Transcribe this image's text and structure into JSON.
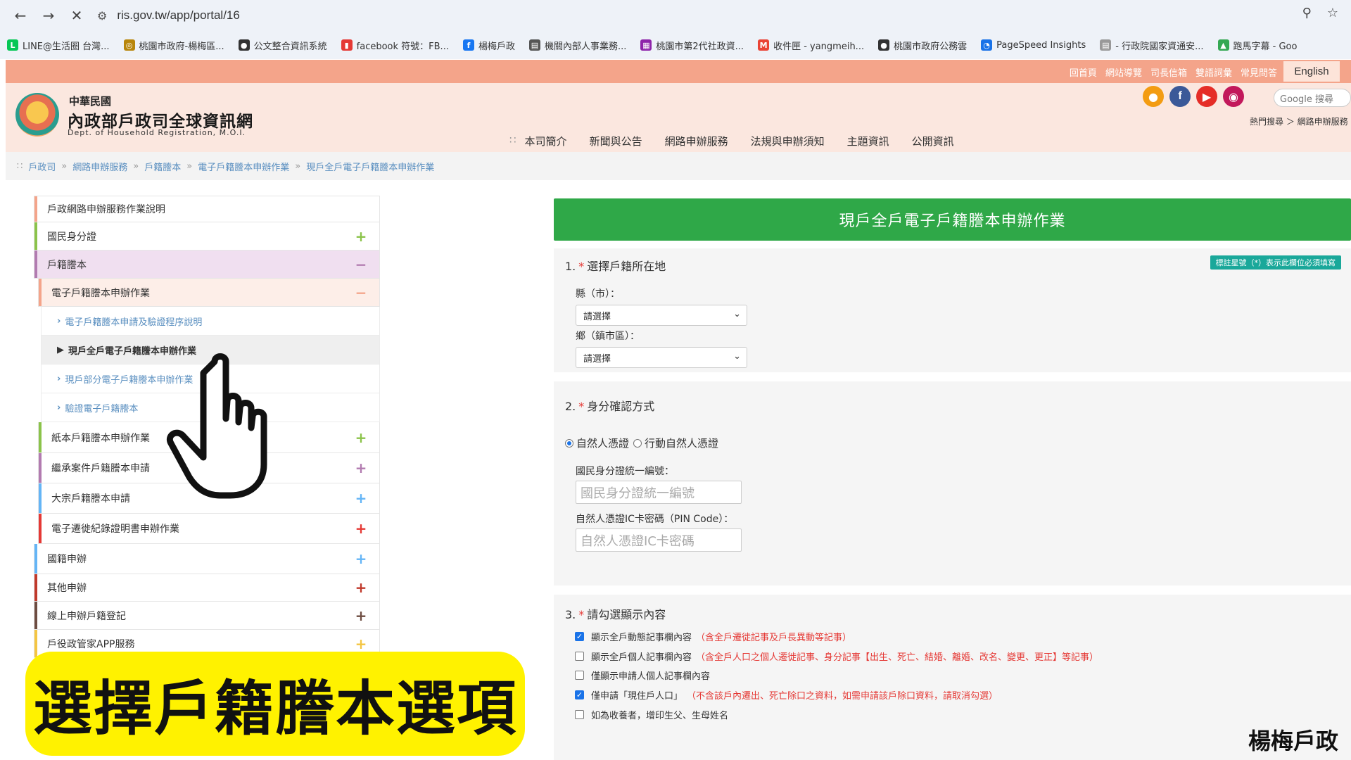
{
  "browser": {
    "url": "ris.gov.tw/app/portal/16",
    "bookmarks": [
      {
        "label": "LINE@生活圈 台灣...",
        "icon": "line-icon",
        "color": "#06c755"
      },
      {
        "label": "桃園市政府-楊梅區...",
        "icon": "seal-icon",
        "color": "#b8860b"
      },
      {
        "label": "公文整合資訊系統",
        "icon": "globe-icon",
        "color": "#333333"
      },
      {
        "label": "facebook 符號：FB...",
        "icon": "bookmark-icon",
        "color": "#e53935"
      },
      {
        "label": "楊梅戶政",
        "icon": "facebook-icon",
        "color": "#1877f2"
      },
      {
        "label": "機關內部人事業務...",
        "icon": "document-icon",
        "color": "#555555"
      },
      {
        "label": "桃園市第2代社政資...",
        "icon": "grid-icon",
        "color": "#8e24aa"
      },
      {
        "label": "收件匣 - yangmeih...",
        "icon": "gmail-icon",
        "color": "#ea4335"
      },
      {
        "label": "桃園市政府公務雲",
        "icon": "globe-icon",
        "color": "#333333"
      },
      {
        "label": "PageSpeed Insights",
        "icon": "speed-icon",
        "color": "#1a73e8"
      },
      {
        "label": "- 行政院國家資通安...",
        "icon": "document-icon",
        "color": "#999999"
      },
      {
        "label": "跑馬字幕 - Goo",
        "icon": "drive-icon",
        "color": "#34a853"
      }
    ]
  },
  "top_links": [
    "回首頁",
    "網站導覽",
    "司長信箱",
    "雙語詞彙",
    "常見問答"
  ],
  "english_label": "English",
  "header": {
    "title_small": "中華民國",
    "title": "內政部戶政司全球資訊網",
    "title_en": "Dept. of Household Registration, M.O.I.",
    "nav": [
      "本司簡介",
      "新聞與公告",
      "網路申辦服務",
      "法規與申辦須知",
      "主題資訊",
      "公開資訊"
    ],
    "google_placeholder": "Google 搜尋",
    "hot_search": "熱門搜尋 ＞ 網路申辦服務"
  },
  "breadcrumb": [
    "戶政司",
    "網路申辦服務",
    "戶籍謄本",
    "電子戶籍謄本申辦作業",
    "現戶全戶電子戶籍謄本申辦作業"
  ],
  "sidebar": {
    "items": [
      {
        "label": "戶政網路申辦服務作業說明",
        "toggle": "",
        "bar": "#f4a48a"
      },
      {
        "label": "國民身分證",
        "toggle": "+",
        "bar": "#8bc34a"
      },
      {
        "label": "戶籍謄本",
        "toggle": "−",
        "bar": "#b27bb0"
      },
      {
        "label": "電子戶籍謄本申辦作業",
        "toggle": "−",
        "bar": "#f4a48a"
      },
      {
        "label": "電子戶籍謄本申請及驗證程序說明",
        "toggle": "",
        "bar": ""
      },
      {
        "label": "現戶全戶電子戶籍謄本申辦作業",
        "toggle": "",
        "bar": ""
      },
      {
        "label": "現戶部分電子戶籍謄本申辦作業",
        "toggle": "",
        "bar": ""
      },
      {
        "label": "驗證電子戶籍謄本",
        "toggle": "",
        "bar": ""
      },
      {
        "label": "紙本戶籍謄本申辦作業",
        "toggle": "+",
        "bar": "#8bc34a"
      },
      {
        "label": "繼承案件戶籍謄本申請",
        "toggle": "+",
        "bar": "#b27bb0"
      },
      {
        "label": "大宗戶籍謄本申請",
        "toggle": "+",
        "bar": "#64b5f6"
      },
      {
        "label": "電子遷徙紀錄證明書申辦作業",
        "toggle": "+",
        "bar": "#e53935"
      },
      {
        "label": "國籍申辦",
        "toggle": "+",
        "bar": "#64b5f6"
      },
      {
        "label": "其他申辦",
        "toggle": "+",
        "bar": "#c0392b"
      },
      {
        "label": "線上申辦戶籍登記",
        "toggle": "+",
        "bar": "#6d4c41"
      },
      {
        "label": "戶役政管家APP服務",
        "toggle": "+",
        "bar": "#f4c542"
      }
    ]
  },
  "form": {
    "header": "現戶全戶電子戶籍謄本申辦作業",
    "required_note": "標註星號（*）表示此欄位必須填寫",
    "section1": {
      "num": "1.",
      "req": "*",
      "title": "選擇戶籍所在地",
      "county_label": "縣（市）：",
      "county_value": "請選擇",
      "town_label": "鄉（鎮市區）：",
      "town_value": "請選擇"
    },
    "section2": {
      "num": "2.",
      "req": "*",
      "title": "身分確認方式",
      "radio1": "自然人憑證",
      "radio2": "行動自然人憑證",
      "id_label": "國民身分證統一編號：",
      "id_placeholder": "國民身分證統一編號",
      "pin_label": "自然人憑證IC卡密碼（PIN Code）：",
      "pin_placeholder": "自然人憑證IC卡密碼"
    },
    "section3": {
      "num": "3.",
      "req": "*",
      "title": "請勾選顯示內容",
      "options": [
        {
          "label": "顯示全戶動態記事欄內容",
          "note": "（含全戶遷徙記事及戶長異動等記事）",
          "checked": true
        },
        {
          "label": "顯示全戶個人記事欄內容",
          "note": "（含全戶人口之個人遷徙記事、身分記事【出生、死亡、結婚、離婚、改名、變更、更正】等記事）",
          "checked": false
        },
        {
          "label": "僅顯示申請人個人記事欄內容",
          "note": "",
          "checked": false
        },
        {
          "label": "僅申請「現住戶人口」",
          "note": "（不含該戶內遷出、死亡除口之資料，如需申請該戶除口資料，請取消勾選）",
          "checked": true
        },
        {
          "label": "如為收養者，增印生父、生母姓名",
          "note": "",
          "checked": false
        }
      ]
    }
  },
  "caption": "選擇戶籍謄本選項",
  "watermark": "楊梅戶政"
}
